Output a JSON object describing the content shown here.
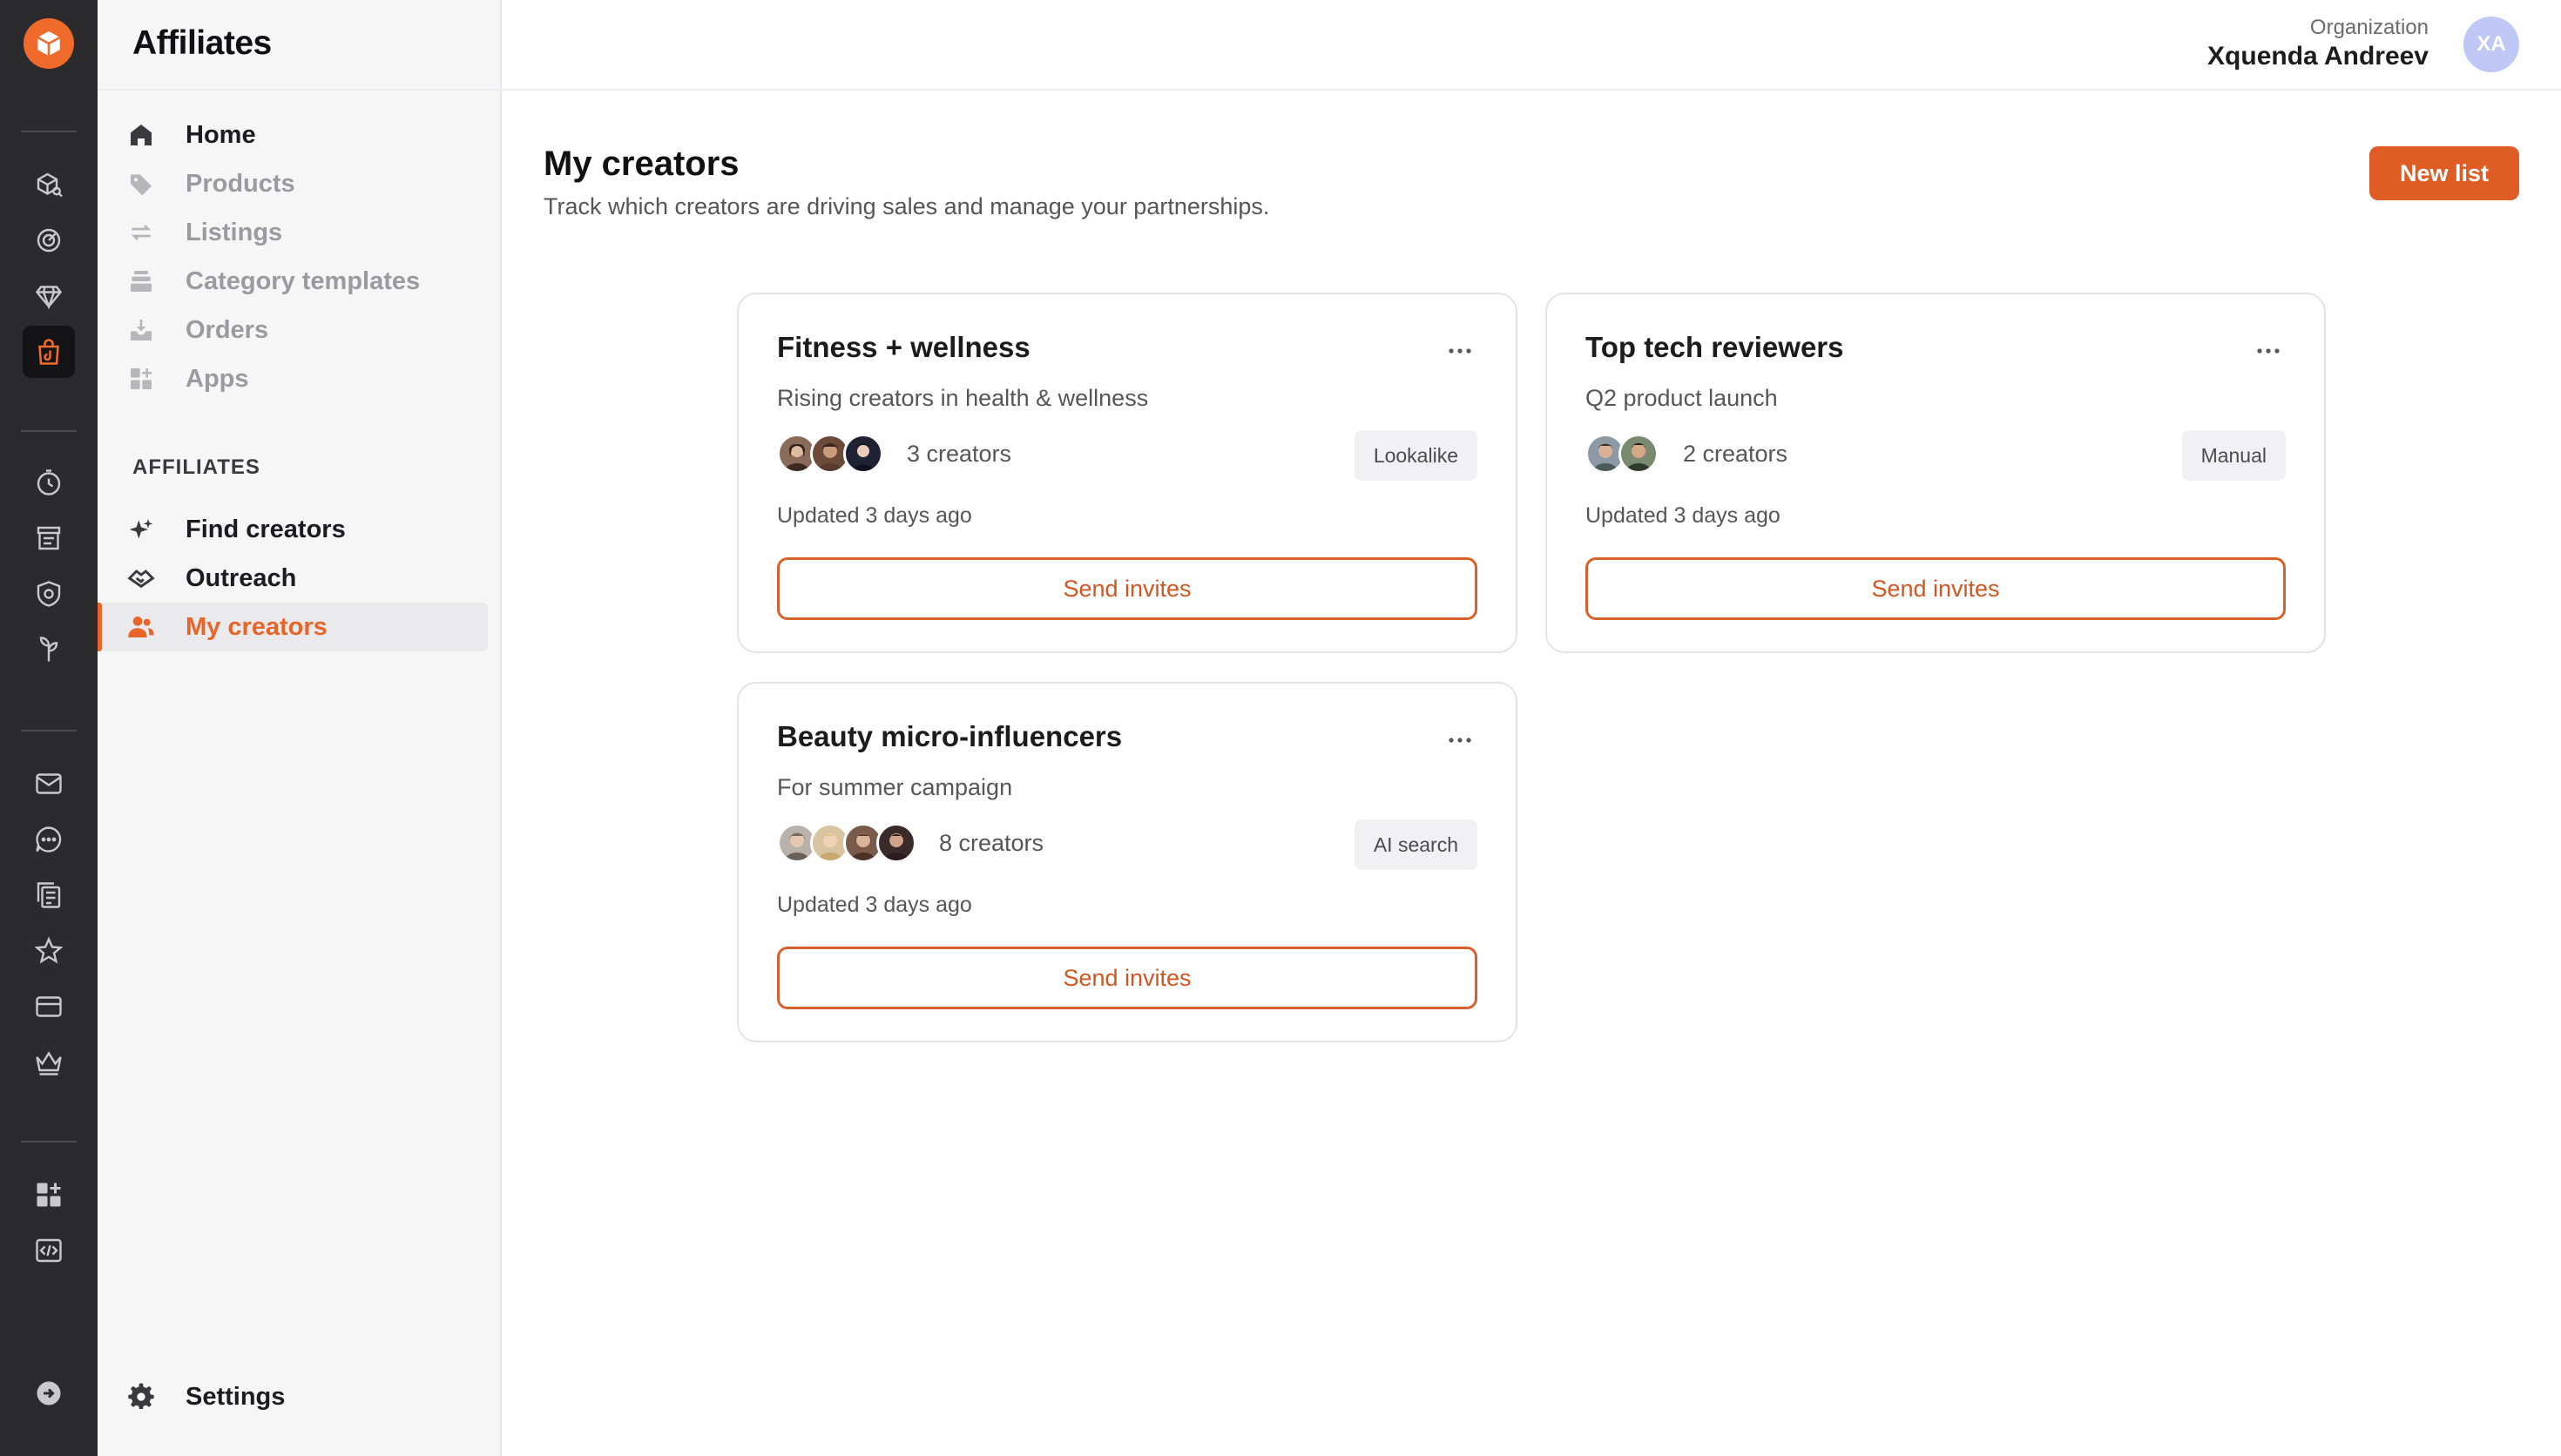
{
  "app": {
    "brand": "Affiliates"
  },
  "header": {
    "org_label": "Organization",
    "org_name": "Xquenda Andreev",
    "avatar_initials": "XA"
  },
  "rail": {
    "icons": [
      "shop-logo-icon",
      "box-search-icon",
      "target-icon",
      "diamond-icon",
      "shopping-bag-icon",
      "clock-icon",
      "storefront-icon",
      "shield-icon",
      "plant-icon",
      "mail-icon",
      "chat-icon",
      "documents-icon",
      "star-icon",
      "card-icon",
      "crown-icon",
      "add-app-icon",
      "code-icon",
      "arrow-right-circle-icon"
    ],
    "active": "shopping-bag-icon"
  },
  "sidebar": {
    "main_items": [
      {
        "label": "Home",
        "icon": "home-icon",
        "enabled": true
      },
      {
        "label": "Products",
        "icon": "tag-icon",
        "enabled": false
      },
      {
        "label": "Listings",
        "icon": "sync-icon",
        "enabled": false
      },
      {
        "label": "Category templates",
        "icon": "stack-icon",
        "enabled": false
      },
      {
        "label": "Orders",
        "icon": "download-box-icon",
        "enabled": false
      },
      {
        "label": "Apps",
        "icon": "apps-icon",
        "enabled": false
      }
    ],
    "section_heading": "AFFILIATES",
    "affiliate_items": [
      {
        "label": "Find creators",
        "icon": "sparkle-icon"
      },
      {
        "label": "Outreach",
        "icon": "handshake-icon"
      },
      {
        "label": "My creators",
        "icon": "people-icon",
        "active": true
      }
    ],
    "settings_label": "Settings"
  },
  "main": {
    "title": "My creators",
    "subtitle": "Track which creators are driving sales and manage your partnerships.",
    "new_list_label": "New list",
    "cards": [
      {
        "title": "Fitness + wellness",
        "description": "Rising creators in health & wellness",
        "creator_count": "3 creators",
        "avatar_count": 3,
        "tag": "Lookalike",
        "updated": "Updated 3 days ago",
        "action": "Send invites"
      },
      {
        "title": "Top tech reviewers",
        "description": "Q2 product launch",
        "creator_count": "2 creators",
        "avatar_count": 2,
        "tag": "Manual",
        "updated": "Updated 3 days ago",
        "action": "Send invites"
      },
      {
        "title": "Beauty micro-influencers",
        "description": "For summer campaign",
        "creator_count": "8 creators",
        "avatar_count": 4,
        "tag": "AI search",
        "updated": "Updated 3 days ago",
        "action": "Send invites"
      }
    ]
  },
  "colors": {
    "accent": "#df5d24",
    "rail_bg": "#2b2b2e",
    "sidebar_bg": "#f6f6f7"
  }
}
